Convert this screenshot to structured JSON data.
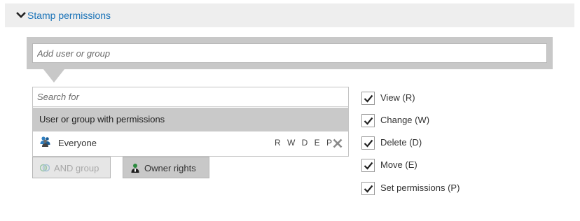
{
  "section": {
    "title": "Stamp permissions",
    "accent_color": "#1a73b8"
  },
  "add_input": {
    "placeholder": "Add user or group",
    "value": ""
  },
  "search": {
    "placeholder": "Search for",
    "value": ""
  },
  "list": {
    "header": "User or group with permissions",
    "rows": [
      {
        "icon": "group-icon",
        "name": "Everyone",
        "rights": "RWDEP"
      }
    ]
  },
  "buttons": {
    "and_group": {
      "label": "AND group",
      "icon": "and-group-icon",
      "enabled": false
    },
    "owner_rights": {
      "label": "Owner rights",
      "icon": "owner-icon",
      "enabled": true
    }
  },
  "permissions": [
    {
      "label": "View (R)",
      "checked": true
    },
    {
      "label": "Change (W)",
      "checked": true
    },
    {
      "label": "Delete (D)",
      "checked": true
    },
    {
      "label": "Move (E)",
      "checked": true
    },
    {
      "label": "Set permissions (P)",
      "checked": true
    }
  ]
}
